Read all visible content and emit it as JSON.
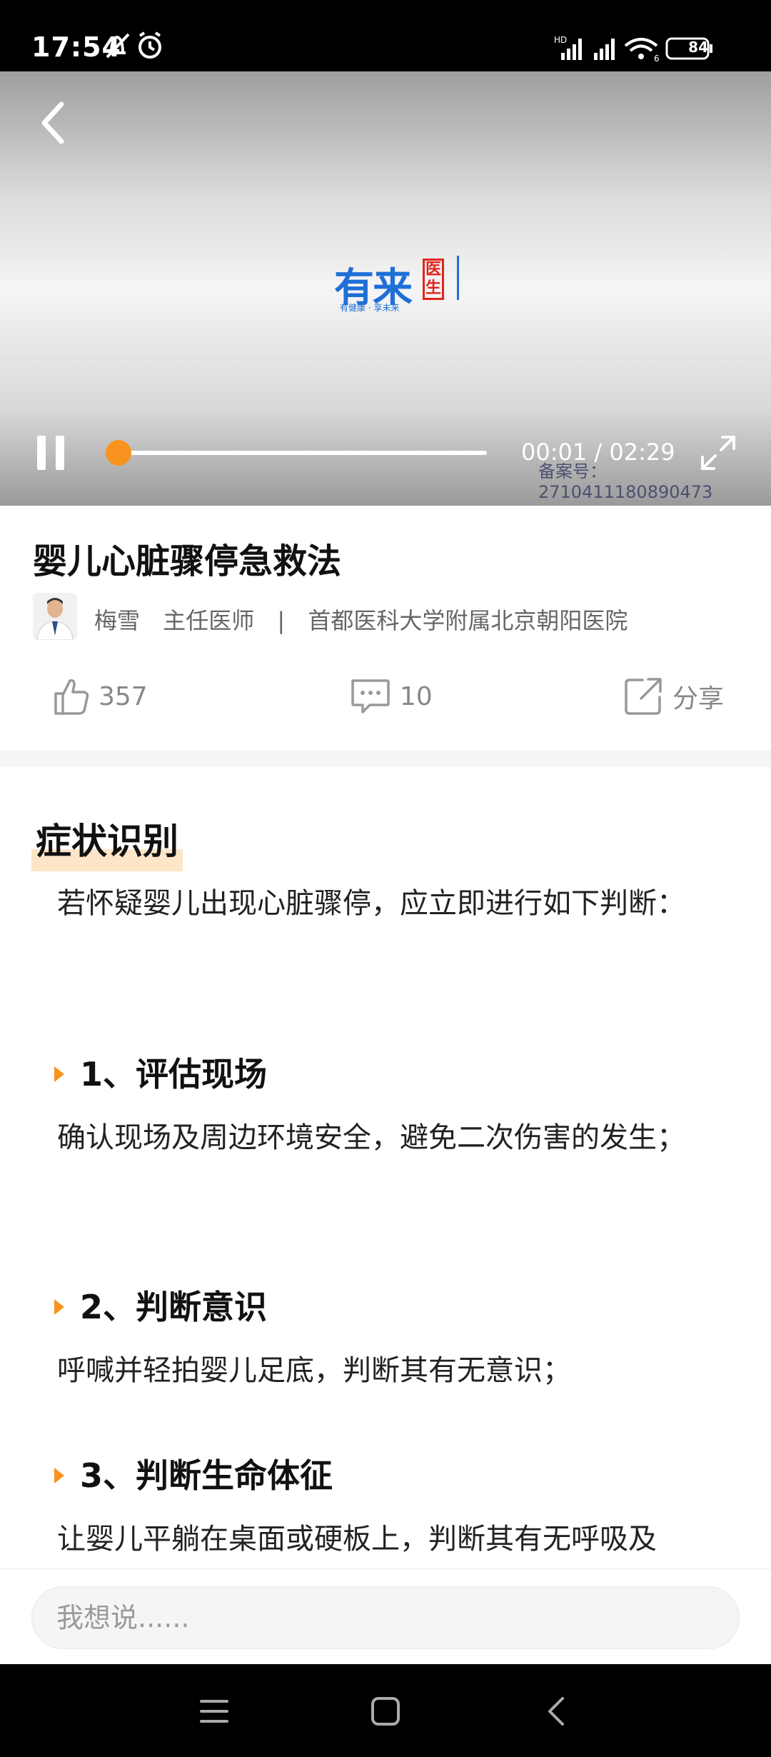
{
  "status_bar": {
    "time": "17:54",
    "icons_left": [
      "bell-off-icon",
      "alarm-icon"
    ],
    "network_label": "HD",
    "wifi_label": "6",
    "battery": "84"
  },
  "video": {
    "logo_text": "有来",
    "logo_badge": "医生",
    "logo_tagline": "有健康 · 享未来",
    "current_time": "00:01",
    "total_time": "02:29",
    "time_display": "00:01 / 02:29",
    "progress": 0.007,
    "record_number": "备案号：2710411180890473"
  },
  "article": {
    "title": "婴儿心脏骤停急救法",
    "author_name": "梅雪",
    "author_title": "主任医师",
    "separator": "|",
    "hospital": "首都医科大学附属北京朝阳医院",
    "likes": "357",
    "comments": "10",
    "share_label": "分享"
  },
  "content": {
    "section_title": "症状识别",
    "intro": "若怀疑婴儿出现心脏骤停，应立即进行如下判断：",
    "steps": [
      {
        "title": "1、评估现场",
        "text": "确认现场及周边环境安全，避免二次伤害的发生；"
      },
      {
        "title": "2、判断意识",
        "text": "呼喊并轻拍婴儿足底，判断其有无意识；"
      },
      {
        "title": "3、判断生命体征",
        "text": "让婴儿平躺在桌面或硬板上，判断其有无呼吸及"
      }
    ]
  },
  "comment": {
    "placeholder": "我想说......"
  },
  "colors": {
    "accent": "#f7931e",
    "brand_blue": "#1f6fd8",
    "brand_red": "#e1251b"
  }
}
